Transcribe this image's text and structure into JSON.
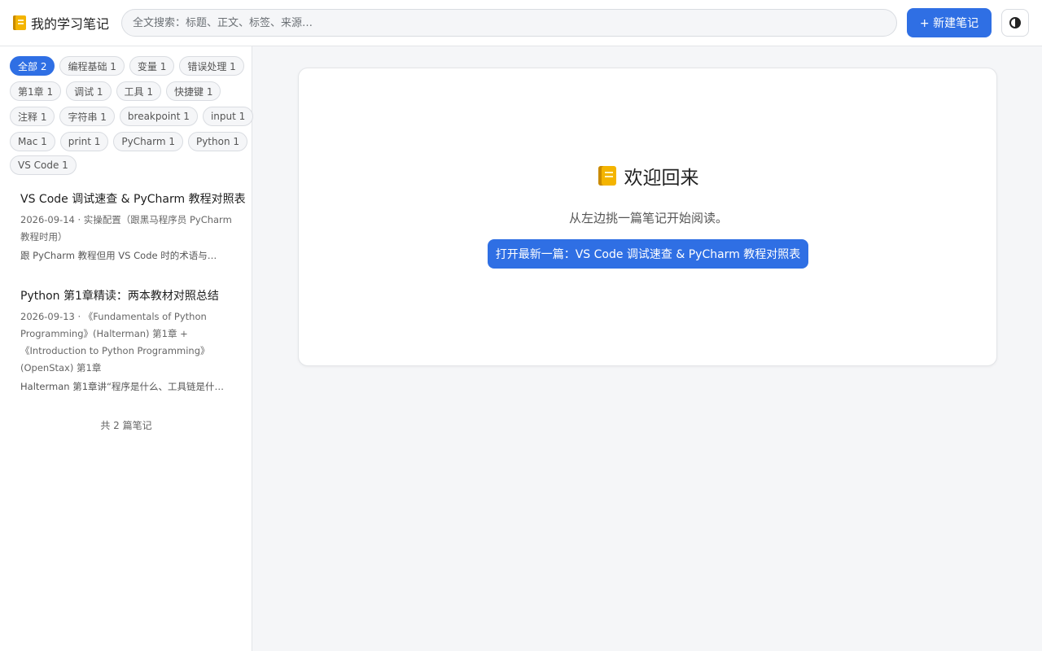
{
  "header": {
    "app_title": "我的学习笔记",
    "logo_icon": "notebook-icon",
    "search_placeholder": "全文搜索：标题、正文、标签、来源…",
    "new_note_label": "+ 新建笔记",
    "theme_icon": "contrast-icon"
  },
  "sidebar": {
    "tags": [
      {
        "label": "全部 2",
        "active": true
      },
      {
        "label": "编程基础 1"
      },
      {
        "label": "变量 1"
      },
      {
        "label": "错误处理 1"
      },
      {
        "label": "第1章 1"
      },
      {
        "label": "调试 1"
      },
      {
        "label": "工具 1"
      },
      {
        "label": "快捷键 1"
      },
      {
        "label": "注释 1"
      },
      {
        "label": "字符串 1"
      },
      {
        "label": "breakpoint 1"
      },
      {
        "label": "input 1"
      },
      {
        "label": "Mac 1"
      },
      {
        "label": "print 1"
      },
      {
        "label": "PyCharm 1"
      },
      {
        "label": "Python 1"
      },
      {
        "label": "VS Code 1"
      }
    ],
    "notes": [
      {
        "title": "VS Code 调试速查 & PyCharm 教程对照表",
        "meta": "2026-09-14 · 实操配置（跟黑马程序员 PyCharm 教程时用）",
        "excerpt": "跟 PyCharm 教程但用 VS Code 时的术语与位…"
      },
      {
        "title": "Python 第1章精读：两本教材对照总结",
        "meta": "2026-09-13 · 《Fundamentals of Python Programming》(Halterman) 第1章 + 《Introduction to Python Programming》(OpenStax) 第1章",
        "excerpt": "Halterman 第1章讲“程序是什么、工具链是什…"
      }
    ],
    "count_label": "共 2 篇笔记"
  },
  "main": {
    "welcome_title": "欢迎回来",
    "welcome_icon": "notebook-icon",
    "subtitle": "从左边挑一篇笔记开始阅读。",
    "open_latest_label": "打开最新一篇：VS Code 调试速查 & PyCharm 教程对照表"
  },
  "colors": {
    "accent": "#2f6fe4",
    "background": "#f5f6f8"
  }
}
